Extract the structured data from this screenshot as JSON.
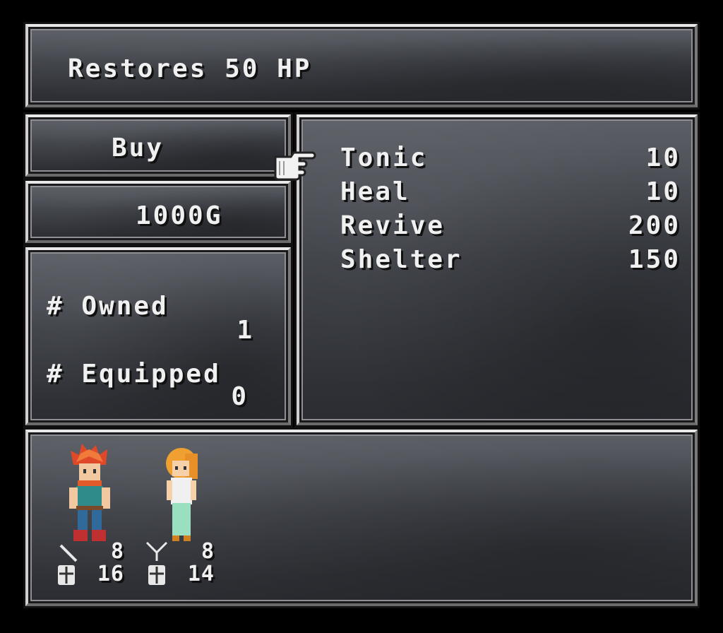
{
  "description": {
    "text": "Restores 50 HP"
  },
  "shop": {
    "mode": "Buy",
    "gold": "1000G",
    "owned_label": "# Owned",
    "owned_value": "1",
    "equipped_label": "# Equipped",
    "equipped_value": "0"
  },
  "items": [
    {
      "name": "Tonic",
      "price": "10"
    },
    {
      "name": "Heal",
      "price": "10"
    },
    {
      "name": "Revive",
      "price": "200"
    },
    {
      "name": "Shelter",
      "price": "150"
    }
  ],
  "party": [
    {
      "name_icon": "crono-sprite",
      "weapon_stat": "8",
      "armor_stat": "16"
    },
    {
      "name_icon": "marle-sprite",
      "weapon_stat": "8",
      "armor_stat": "14"
    }
  ],
  "colors": {
    "panel_top": "#5c5f66",
    "panel_bottom": "#2a2c31",
    "text": "#f0f0f0"
  }
}
